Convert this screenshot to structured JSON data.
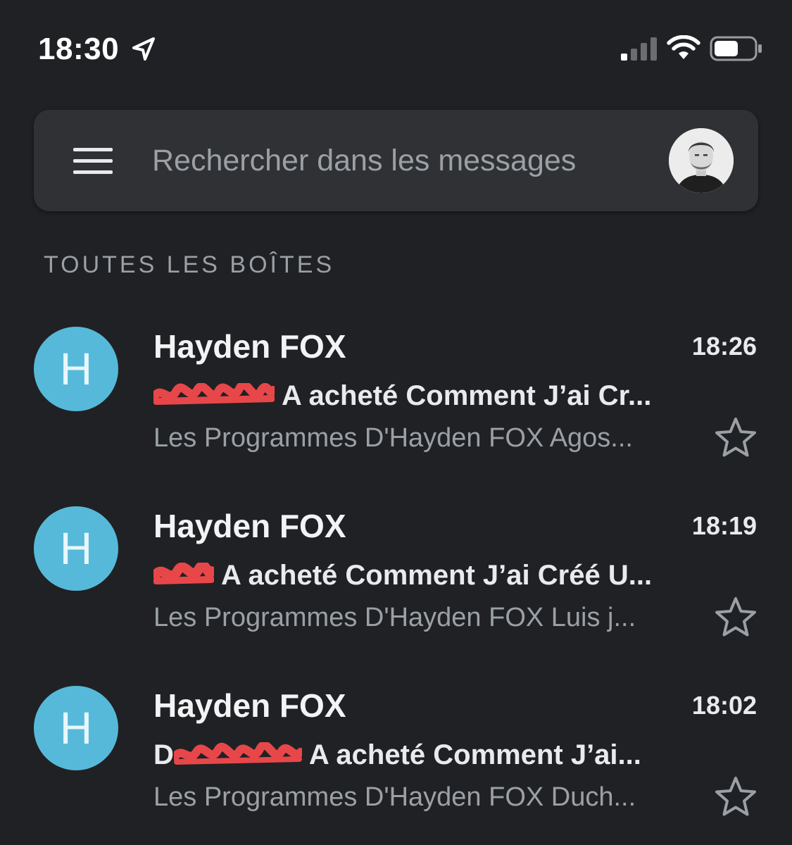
{
  "status_bar": {
    "time": "18:30",
    "icons": [
      "location-arrow-icon",
      "cellular-signal-icon",
      "wifi-icon",
      "battery-icon"
    ]
  },
  "search": {
    "placeholder": "Rechercher dans les messages",
    "menu_icon": "hamburger-menu-icon",
    "avatar": "account-avatar"
  },
  "section": {
    "title": "TOUTES LES BOÎTES"
  },
  "colors": {
    "background": "#202124",
    "search_bar": "#303134",
    "avatar_blue": "#56b9da",
    "redaction_red": "#e8474a"
  },
  "emails": [
    {
      "avatar_letter": "H",
      "sender": "Hayden FOX",
      "time": "18:26",
      "subject_prefix": "",
      "subject": "A acheté Comment J’ai Cr...",
      "preview": "Les Programmes D'Hayden FOX Agos...",
      "starred": false
    },
    {
      "avatar_letter": "H",
      "sender": "Hayden FOX",
      "time": "18:19",
      "subject_prefix": "",
      "subject": "A acheté Comment J’ai Créé U...",
      "preview": "Les Programmes D'Hayden FOX Luis j...",
      "starred": false
    },
    {
      "avatar_letter": "H",
      "sender": "Hayden FOX",
      "time": "18:02",
      "subject_prefix": "D",
      "subject": "A acheté Comment J’ai...",
      "preview": "Les Programmes D'Hayden FOX Duch...",
      "starred": false
    }
  ]
}
